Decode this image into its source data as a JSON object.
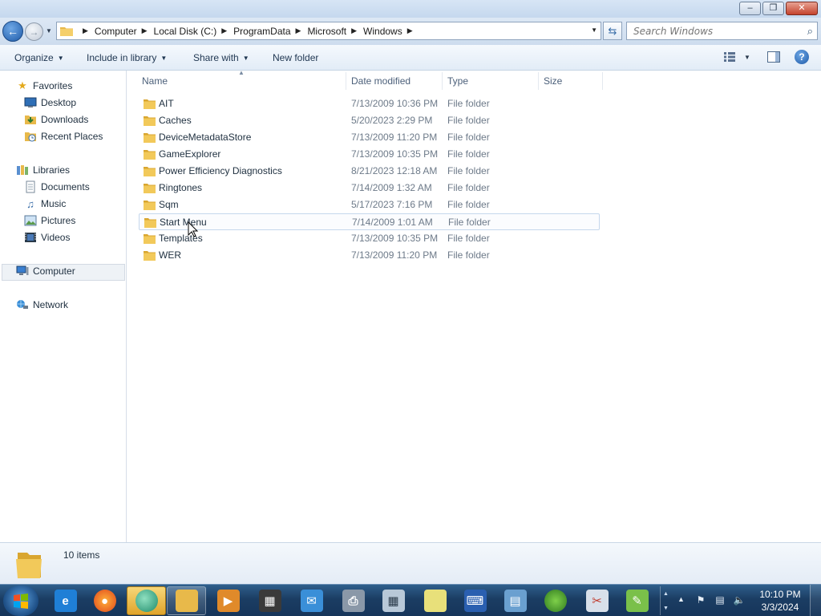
{
  "window": {
    "minimize": "–",
    "maximize": "❐",
    "close": "✕"
  },
  "addressbar": {
    "breadcrumbs": [
      "Computer",
      "Local Disk (C:)",
      "ProgramData",
      "Microsoft",
      "Windows"
    ],
    "search_placeholder": "Search Windows"
  },
  "toolbar": {
    "organize": "Organize",
    "include_in_library": "Include in library",
    "share_with": "Share with",
    "new_folder": "New folder"
  },
  "navpane": {
    "favorites": {
      "label": "Favorites",
      "items": [
        "Desktop",
        "Downloads",
        "Recent Places"
      ]
    },
    "libraries": {
      "label": "Libraries",
      "items": [
        "Documents",
        "Music",
        "Pictures",
        "Videos"
      ]
    },
    "computer": "Computer",
    "network": "Network"
  },
  "columns": {
    "name": "Name",
    "date_modified": "Date modified",
    "type": "Type",
    "size": "Size"
  },
  "files": [
    {
      "name": "AIT",
      "date": "7/13/2009 10:36 PM",
      "type": "File folder"
    },
    {
      "name": "Caches",
      "date": "5/20/2023 2:29 PM",
      "type": "File folder"
    },
    {
      "name": "DeviceMetadataStore",
      "date": "7/13/2009 11:20 PM",
      "type": "File folder"
    },
    {
      "name": "GameExplorer",
      "date": "7/13/2009 10:35 PM",
      "type": "File folder"
    },
    {
      "name": "Power Efficiency Diagnostics",
      "date": "8/21/2023 12:18 AM",
      "type": "File folder"
    },
    {
      "name": "Ringtones",
      "date": "7/14/2009 1:32 AM",
      "type": "File folder"
    },
    {
      "name": "Sqm",
      "date": "5/17/2023 7:16 PM",
      "type": "File folder"
    },
    {
      "name": "Start Menu",
      "date": "7/14/2009 1:01 AM",
      "type": "File folder"
    },
    {
      "name": "Templates",
      "date": "7/13/2009 10:35 PM",
      "type": "File folder"
    },
    {
      "name": "WER",
      "date": "7/13/2009 11:20 PM",
      "type": "File folder"
    }
  ],
  "details": {
    "item_count": "10 items"
  },
  "taskbar": {
    "time": "10:10 PM",
    "date": "3/3/2024"
  }
}
